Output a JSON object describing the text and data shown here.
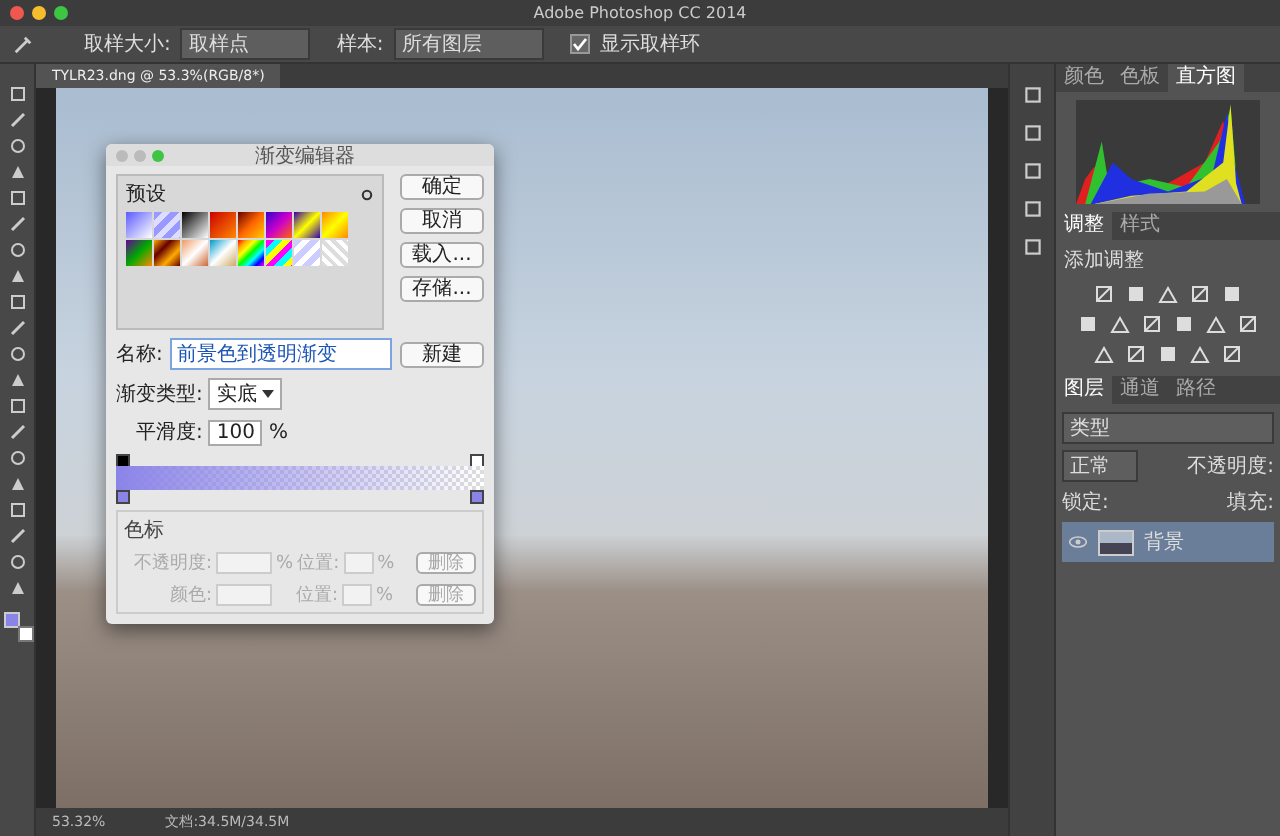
{
  "window": {
    "title": "Adobe Photoshop CC 2014"
  },
  "options_bar": {
    "fields": [
      {
        "label": "取样大小:",
        "value": "取样点"
      },
      {
        "label": "样本:",
        "value": "所有图层"
      }
    ],
    "checkbox": {
      "label": "显示取样环",
      "checked": true
    }
  },
  "document_tab": {
    "title": "TYLR23.dng @ 53.3%(RGB/8*)"
  },
  "gradient_editor": {
    "title": "渐变编辑器",
    "presets_label": "预设",
    "buttons": [
      "确定",
      "取消",
      "载入...",
      "存储..."
    ],
    "name_label": "名称:",
    "name_value": "前景色到透明渐变",
    "new_button": "新建",
    "type_label": "渐变类型:",
    "type_value": "实底",
    "smoothness_label": "平滑度:",
    "smoothness_value": "100",
    "smoothness_unit": "%",
    "stops": {
      "title": "色标",
      "disabled": true,
      "rows": [
        {
          "label": "不透明度:",
          "unit": "%",
          "position_label": "位置:",
          "position_unit": "%",
          "delete": "删除"
        },
        {
          "label": "颜色:",
          "position_label": "位置:",
          "position_unit": "%",
          "delete": "删除"
        }
      ]
    }
  },
  "panels": {
    "top_tabs": [
      {
        "label": "颜色",
        "selected": false
      },
      {
        "label": "色板",
        "selected": false
      },
      {
        "label": "直方图",
        "selected": true
      }
    ],
    "adjust_tabs": [
      {
        "label": "调整",
        "selected": true
      },
      {
        "label": "样式",
        "selected": false
      }
    ],
    "adjust_title": "添加调整",
    "layer_tabs": [
      {
        "label": "图层",
        "selected": true
      },
      {
        "label": "通道",
        "selected": false
      },
      {
        "label": "路径",
        "selected": false
      }
    ],
    "layer_filter": "类型",
    "blend_mode": "正常",
    "opacity_label": "不透明度:",
    "lock_label": "锁定:",
    "fill_label": "填充:",
    "layers": [
      {
        "name": "背景",
        "visible": true,
        "selected": true
      }
    ]
  },
  "status_bar": {
    "zoom": "53.32%",
    "doc_info": "文档:34.5M/34.5M"
  }
}
